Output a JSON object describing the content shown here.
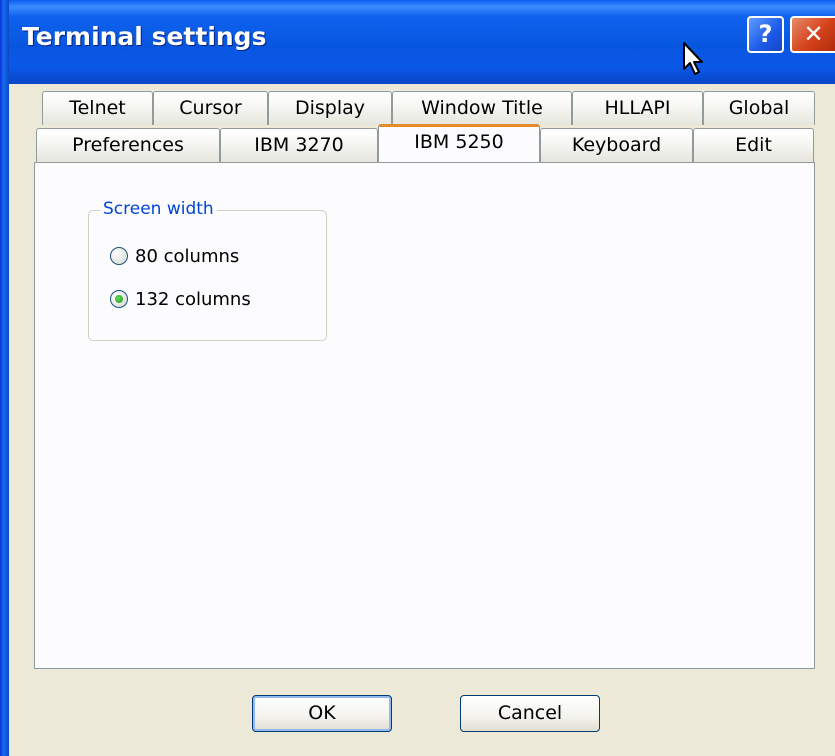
{
  "window": {
    "title": "Terminal settings",
    "help_label": "?",
    "close_label": "✕"
  },
  "tabs_row1": [
    "Telnet",
    "Cursor",
    "Display",
    "Window Title",
    "HLLAPI",
    "Global"
  ],
  "tabs_row2": [
    "Preferences",
    "IBM 3270",
    "IBM 5250",
    "Keyboard",
    "Edit"
  ],
  "active_tab": "IBM 5250",
  "screen_width_group": {
    "label": "Screen width",
    "options": [
      {
        "label": "80 columns",
        "selected": false
      },
      {
        "label": "132 columns",
        "selected": true
      }
    ]
  },
  "buttons": {
    "ok": "OK",
    "cancel": "Cancel"
  },
  "colors": {
    "titlebar": "#0856e0",
    "active_tab_accent": "#e68b2c",
    "group_label": "#0046d5",
    "dialog_bg": "#ece9d8"
  }
}
